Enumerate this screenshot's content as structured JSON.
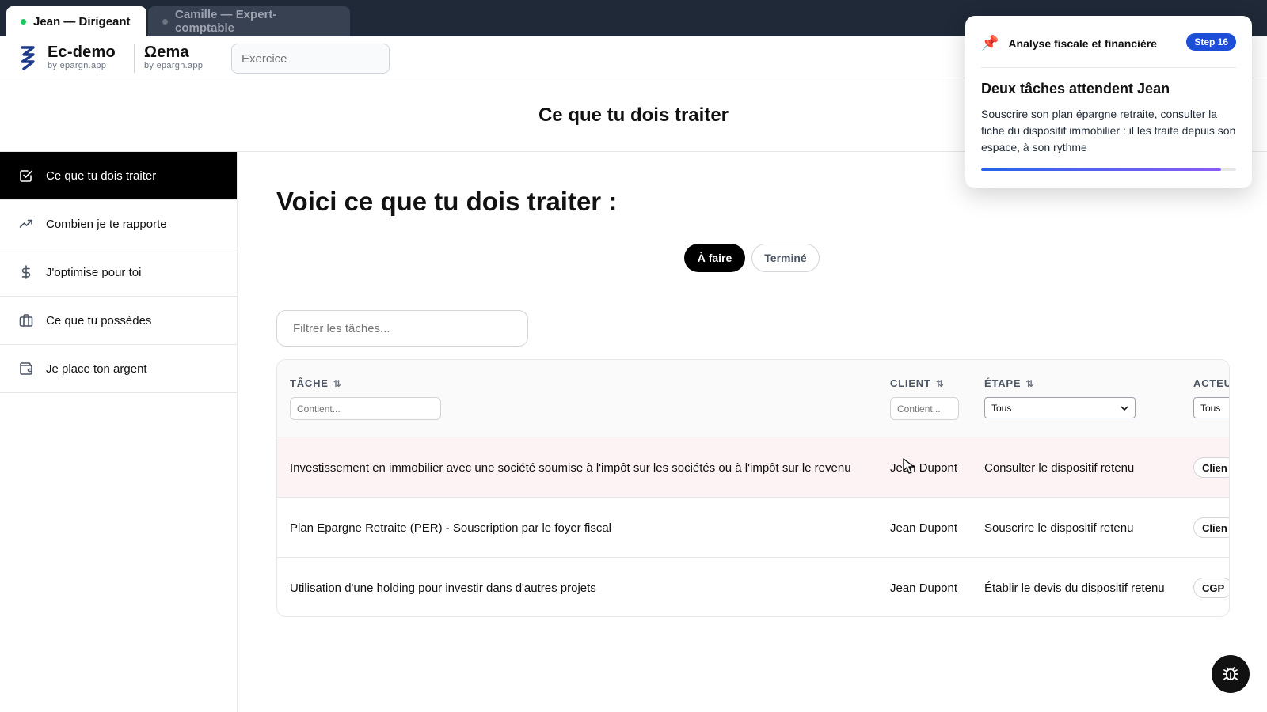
{
  "tabs": [
    {
      "label": "Jean — Dirigeant",
      "active": true
    },
    {
      "label": "Camille — Expert-comptable",
      "active": false
    }
  ],
  "header": {
    "brand1": {
      "name": "Ec-demo",
      "sub": "by epargn.app"
    },
    "brand2": {
      "name": "Ωema",
      "sub": "by epargn.app"
    },
    "exercice_placeholder": "Exercice"
  },
  "page_title": "Ce que tu dois traiter",
  "sidebar": {
    "items": [
      {
        "label": "Ce que tu dois traiter",
        "icon": "check-square-icon",
        "active": true
      },
      {
        "label": "Combien je te rapporte",
        "icon": "trending-up-icon",
        "active": false
      },
      {
        "label": "J'optimise pour toi",
        "icon": "dollar-icon",
        "active": false
      },
      {
        "label": "Ce que tu possèdes",
        "icon": "briefcase-icon",
        "active": false
      },
      {
        "label": "Je place ton argent",
        "icon": "wallet-icon",
        "active": false
      }
    ]
  },
  "main": {
    "heading": "Voici ce que tu dois traiter :",
    "toggle": {
      "active": "À faire",
      "inactive": "Terminé"
    },
    "filter_placeholder": "Filtrer les tâches..."
  },
  "table": {
    "columns": {
      "task": "TÂCHE",
      "client": "CLIENT",
      "stage": "ÉTAPE",
      "actor": "ACTEU"
    },
    "column_filters": {
      "task_placeholder": "Contient...",
      "client_placeholder": "Contient...",
      "stage_value": "Tous",
      "actor_value": "Tous"
    },
    "rows": [
      {
        "task": "Investissement en immobilier avec une société soumise à l'impôt sur les sociétés ou à l'impôt sur le revenu",
        "client": "Jean Dupont",
        "stage": "Consulter le dispositif retenu",
        "actor": "Clien"
      },
      {
        "task": "Plan Epargne Retraite (PER) - Souscription par le foyer fiscal",
        "client": "Jean Dupont",
        "stage": "Souscrire le dispositif retenu",
        "actor": "Clien"
      },
      {
        "task": "Utilisation d'une holding pour investir dans d'autres projets",
        "client": "Jean Dupont",
        "stage": "Établir le devis du dispositif retenu",
        "actor": "CGP"
      }
    ]
  },
  "popover": {
    "section": "Analyse fiscale et financière",
    "step": "Step 16",
    "title": "Deux tâches attendent Jean",
    "body": "Souscrire son plan épargne retraite, consulter la fiche du dispositif immobilier : il les traite depuis son espace, à son rythme",
    "progress": 0.94
  },
  "colors": {
    "accent": "#1d4ed8",
    "active_dot": "#22c55e",
    "row_highlight": "#fdf2f4"
  }
}
